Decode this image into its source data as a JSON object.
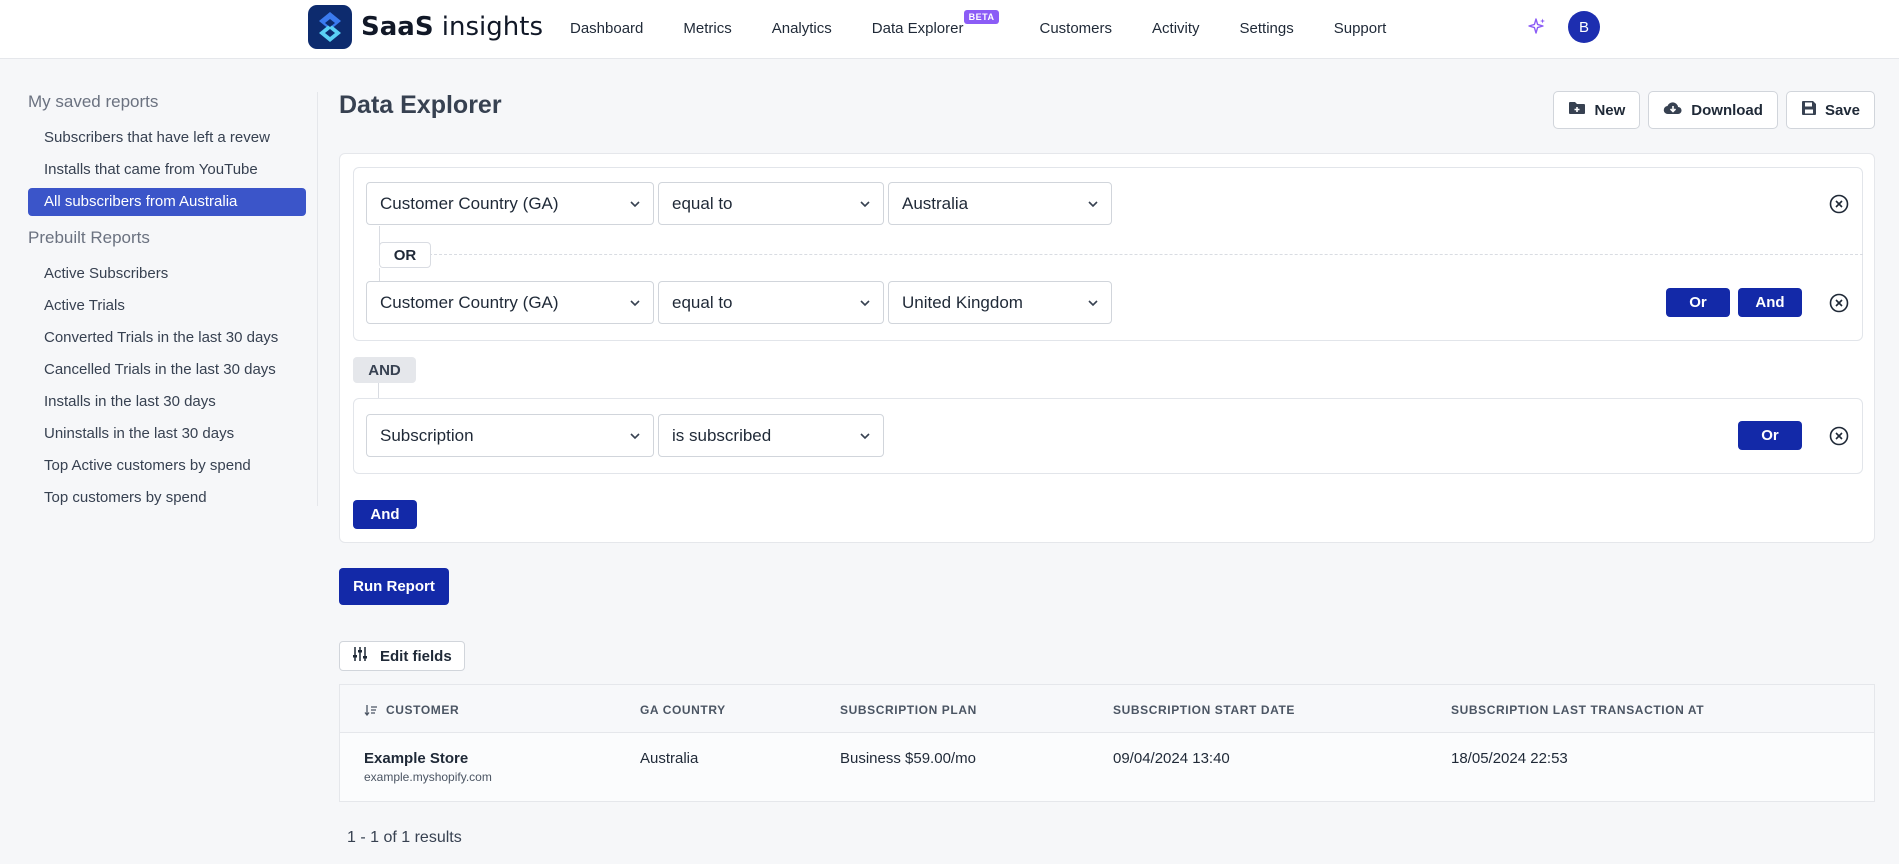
{
  "brand": {
    "name_bold": "SaaS",
    "name_rest": " insights"
  },
  "nav": {
    "items": [
      "Dashboard",
      "Metrics",
      "Analytics",
      "Data Explorer",
      "Customers",
      "Activity",
      "Settings",
      "Support"
    ],
    "beta_badge": "BETA",
    "avatar_initial": "B"
  },
  "sidebar": {
    "saved_heading": "My saved reports",
    "saved": [
      "Subscribers that have left a revew",
      "Installs that came from YouTube",
      "All subscribers from Australia"
    ],
    "active_index": 2,
    "prebuilt_heading": "Prebuilt Reports",
    "prebuilt": [
      "Active Subscribers",
      "Active Trials",
      "Converted Trials in the last 30 days",
      "Cancelled Trials in the last 30 days",
      "Installs in the last 30 days",
      "Uninstalls in the last 30 days",
      "Top Active customers by spend",
      "Top customers by spend"
    ]
  },
  "page": {
    "title": "Data Explorer",
    "actions": {
      "new": "New",
      "download": "Download",
      "save": "Save"
    }
  },
  "filters": {
    "group1": {
      "row1": {
        "field": "Customer Country (GA)",
        "operator": "equal to",
        "value": "Australia"
      },
      "or_label": "OR",
      "row2": {
        "field": "Customer Country (GA)",
        "operator": "equal to",
        "value": "United Kingdom"
      },
      "or_button": "Or",
      "and_button": "And"
    },
    "and_label": "AND",
    "group2": {
      "row1": {
        "field": "Subscription",
        "operator": "is subscribed"
      },
      "or_button": "Or"
    },
    "and_button": "And"
  },
  "run_button": "Run Report",
  "edit_fields": "Edit fields",
  "table": {
    "headers": [
      "CUSTOMER",
      "GA COUNTRY",
      "SUBSCRIPTION PLAN",
      "SUBSCRIPTION START DATE",
      "SUBSCRIPTION LAST TRANSACTION AT"
    ],
    "rows": [
      {
        "customer": "Example Store",
        "domain": "example.myshopify.com",
        "country": "Australia",
        "plan": "Business $59.00/mo",
        "start": "09/04/2024 13:40",
        "last": "18/05/2024 22:53"
      }
    ]
  },
  "results_text": "1 - 1 of 1 results",
  "colors": {
    "primary": "#1329a8",
    "sidebar_active": "#3b55c9",
    "beta": "#8b5cf6",
    "brand_dark": "#0d2b6e"
  }
}
